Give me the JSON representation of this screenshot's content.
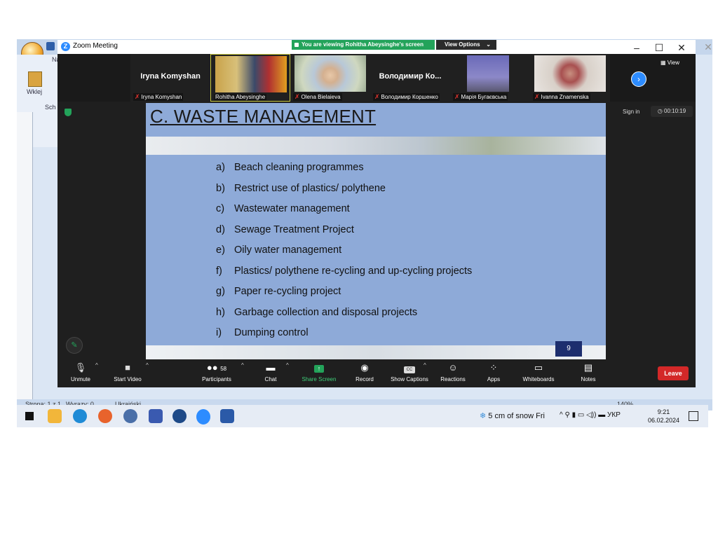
{
  "word": {
    "ribbon_label_paste": "Wklej",
    "ribbon_label_na": "Na",
    "ribbon_label_sch": "Sch",
    "status_page": "Strona: 1 z 1",
    "status_words": "Wyrazy: 0",
    "status_lang": "Ukraiński",
    "status_zoom": "140%"
  },
  "zoom": {
    "title": "Zoom Meeting",
    "viewing_banner": "You are viewing Rohitha Abeysinghe's screen",
    "view_options": "View Options",
    "view_label": "View",
    "sign_in": "Sign in",
    "timer": "00:10:19",
    "participants": [
      {
        "name": "Iryna Komyshan",
        "label": "Iryna Komyshan",
        "has_video": false
      },
      {
        "name": "",
        "label": "Rohitha Abeysinghe",
        "has_video": true
      },
      {
        "name": "",
        "label": "Olena Bielaieva",
        "has_video": true
      },
      {
        "name": "Володимир Ко...",
        "label": "Володимир Коршенко",
        "has_video": false
      },
      {
        "name": "",
        "label": "Марія Бугаєвська",
        "has_video": true
      },
      {
        "name": "",
        "label": "Ivanna Znamenska",
        "has_video": true
      }
    ],
    "toolbar": {
      "unmute": "Unmute",
      "start_video": "Start Video",
      "participants": "Participants",
      "participants_count": "58",
      "chat": "Chat",
      "share_screen": "Share Screen",
      "record": "Record",
      "show_captions": "Show Captions",
      "reactions": "Reactions",
      "apps": "Apps",
      "whiteboards": "Whiteboards",
      "notes": "Notes",
      "leave": "Leave"
    }
  },
  "slide": {
    "title": "C. WASTE MANAGEMENT",
    "items": [
      {
        "letter": "a)",
        "text": "Beach cleaning programmes"
      },
      {
        "letter": "b)",
        "text": "Restrict use of plastics/ polythene"
      },
      {
        "letter": "c)",
        "text": "Wastewater management"
      },
      {
        "letter": "d)",
        "text": "Sewage Treatment Project"
      },
      {
        "letter": "e)",
        "text": "Oily water management"
      },
      {
        "letter": "f)",
        "text": "Plastics/ polythene re-cycling and up-cycling projects"
      },
      {
        "letter": "g)",
        "text": "Paper re-cycling project"
      },
      {
        "letter": "h)",
        "text": "Garbage collection and disposal projects"
      },
      {
        "letter": "i)",
        "text": "Dumping control"
      }
    ],
    "page_number": "9"
  },
  "taskbar": {
    "weather": "5 cm of snow Fri",
    "language": "УКР",
    "time": "9:21",
    "date": "06.02.2024"
  }
}
